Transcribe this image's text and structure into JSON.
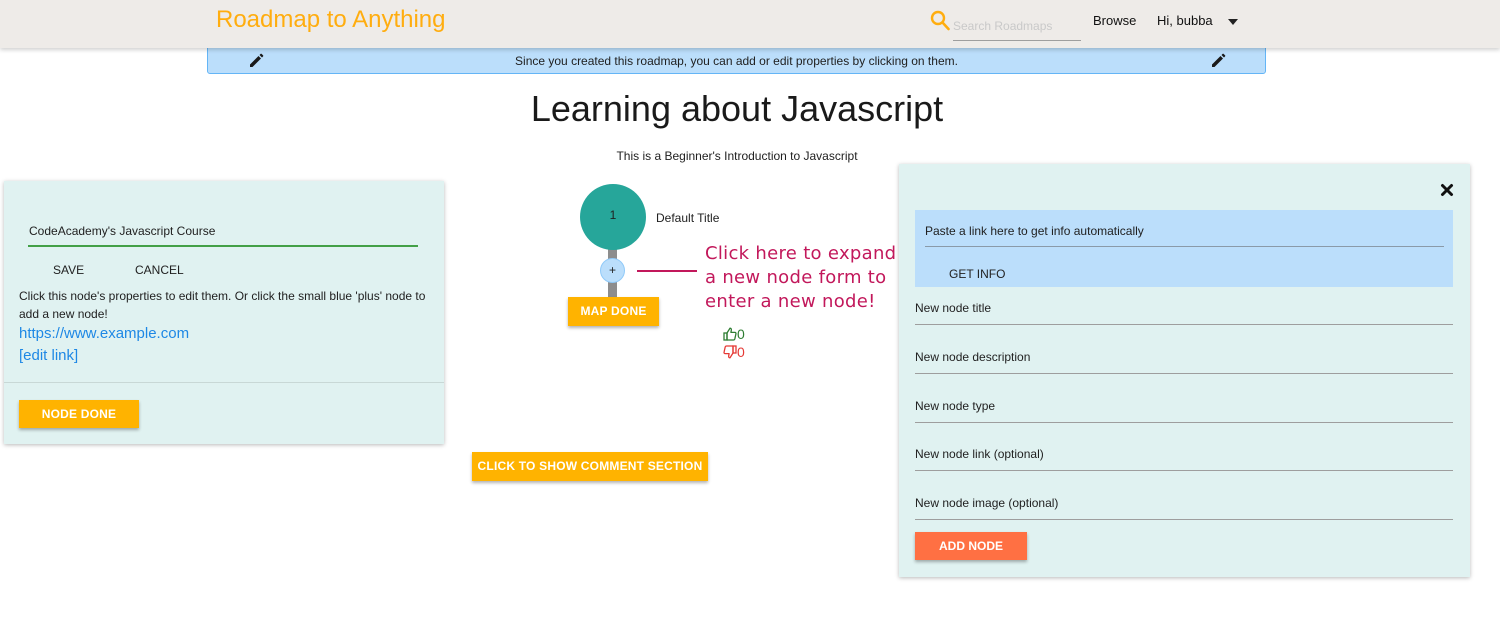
{
  "header": {
    "brand": "Roadmap to Anything",
    "search_placeholder": "Search Roadmaps",
    "browse": "Browse",
    "user_greeting": "Hi, bubba",
    "icons": [
      "search-icon",
      "chevron-down-icon"
    ]
  },
  "banner": {
    "text": "Since you created this roadmap, you can add or edit properties by clicking on them.",
    "icons": [
      "pencil-icon",
      "pencil-icon"
    ]
  },
  "roadmap": {
    "title": "Learning about Javascript",
    "description": "This is a Beginner's Introduction to Javascript"
  },
  "node_editor": {
    "title_value": "CodeAcademy's Javascript Course",
    "save_label": "SAVE",
    "cancel_label": "CANCEL",
    "help_text": "Click this node's properties to edit them. Or click the small blue 'plus' node to add a new node!",
    "link": "https://www.example.com",
    "edit_link": "[edit link]",
    "done_label": "NODE DONE"
  },
  "graph": {
    "node_number": "1",
    "node_title": "Default Title",
    "plus_label": "+",
    "map_done_label": "MAP DONE",
    "annotation_lines": [
      "Click here to expand",
      "a new node form to",
      "enter a new node!"
    ],
    "upvotes": "0",
    "downvotes": "0",
    "comments_label": "CLICK TO SHOW COMMENT SECTION",
    "colors": {
      "node": "#26a69a",
      "plus_node": "#bbdefb",
      "annotation": "#c2185b",
      "upvote": "#2e7d32",
      "downvote": "#e53935"
    }
  },
  "new_node_form": {
    "autofill_placeholder": "Paste a link here to get info automatically",
    "get_info_label": "GET INFO",
    "title_placeholder": "New node title",
    "description_placeholder": "New node description",
    "type_placeholder": "New node type",
    "link_placeholder": "New node link (optional)",
    "image_placeholder": "New node image (optional)",
    "add_label": "ADD NODE",
    "icons": [
      "close-icon"
    ]
  },
  "colors": {
    "brand": "#ffad0f",
    "primary_button": "#ffb300",
    "add_button": "#ff7043",
    "panel_background": "#e0f2f1",
    "banner_background": "#bbdefb",
    "link": "#1e88e5"
  }
}
